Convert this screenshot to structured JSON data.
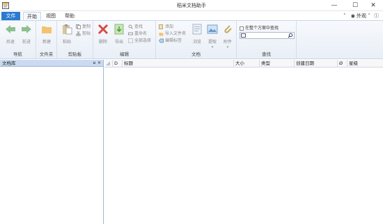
{
  "window": {
    "title": "稻米文档助手",
    "controls": [
      "—",
      "☐",
      "✕"
    ]
  },
  "tabs": {
    "file": "文件",
    "home": "开始",
    "view": "视图",
    "help": "帮助"
  },
  "top_right": {
    "appearance": "外观"
  },
  "ribbon": {
    "nav": {
      "label": "导航",
      "back": "后退",
      "forward": "前进"
    },
    "folder": {
      "label": "文件夹",
      "new": "新建"
    },
    "clipboard": {
      "label": "剪贴板",
      "paste": "粘贴",
      "copy": "复制",
      "cut": "剪贴"
    },
    "edit": {
      "label": "编辑",
      "delete": "删除",
      "export": "导出",
      "find": "查找",
      "rename": "重命名",
      "select_all": "全部选择"
    },
    "document": {
      "label": "文档",
      "add": "添加",
      "import_folder": "导入文件夹",
      "edit_tags": "编辑标签",
      "browse": "浏览",
      "extract": "提取",
      "attach": "附件"
    },
    "search": {
      "label": "查找",
      "in_scheme": "在整个方案中查找",
      "placeholder": ""
    }
  },
  "left_panel": {
    "title": "文档库",
    "pin": "ᵾ",
    "close": "✕"
  },
  "grid": {
    "columns": [
      "D",
      "标题",
      "大小",
      "类型",
      "创建日期",
      "Ø",
      "星级"
    ]
  },
  "colors": {
    "file_tab": "#2b79d0",
    "ribbon_border": "#c6d7ec",
    "panel_header": "#c9daf1"
  }
}
